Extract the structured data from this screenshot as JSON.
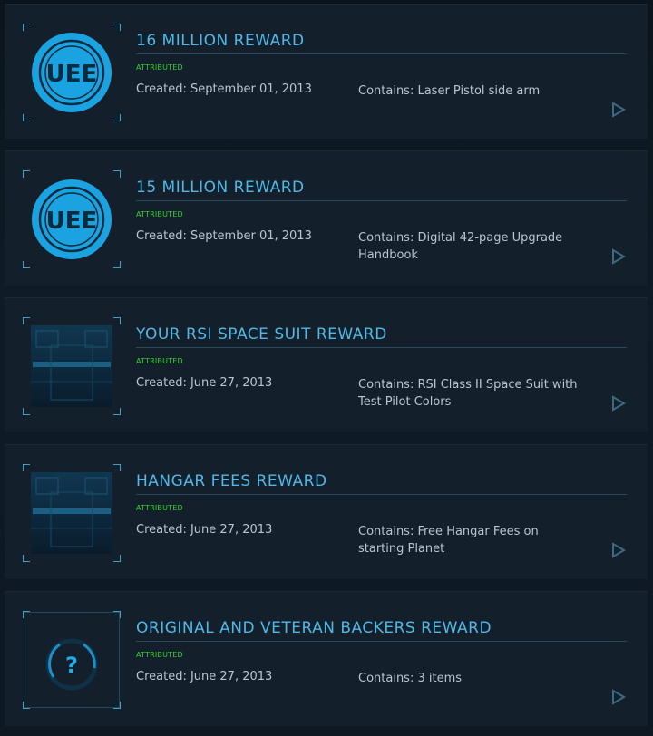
{
  "pledges": [
    {
      "title": "16 MILLION REWARD",
      "status": "ATTRIBUTED",
      "created": "Created: September 01, 2013",
      "contains": "Contains: Laser Pistol side arm",
      "image": "uee-emblem-icon"
    },
    {
      "title": "15 MILLION REWARD",
      "status": "ATTRIBUTED",
      "created": "Created: September 01, 2013",
      "contains": "Contains: Digital 42-page Upgrade Handbook",
      "image": "uee-emblem-icon"
    },
    {
      "title": "YOUR RSI SPACE SUIT REWARD",
      "status": "ATTRIBUTED",
      "created": "Created: June 27, 2013",
      "contains": "Contains: RSI Class II Space Suit with Test Pilot Colors",
      "image": "hangar-thumbnail"
    },
    {
      "title": "HANGAR FEES REWARD",
      "status": "ATTRIBUTED",
      "created": "Created: June 27, 2013",
      "contains": "Contains: Free Hangar Fees on starting Planet",
      "image": "hangar-thumbnail"
    },
    {
      "title": "ORIGINAL AND VETERAN BACKERS REWARD",
      "status": "ATTRIBUTED",
      "created": "Created: June 27, 2013",
      "contains": "Contains: 3 items",
      "image": "question-mark-icon"
    }
  ],
  "colors": {
    "title": "#4fb8e6",
    "status": "#35d12e",
    "text": "#b9c6cf",
    "panel": "#131f2a",
    "accent": "#3aa0c8"
  }
}
